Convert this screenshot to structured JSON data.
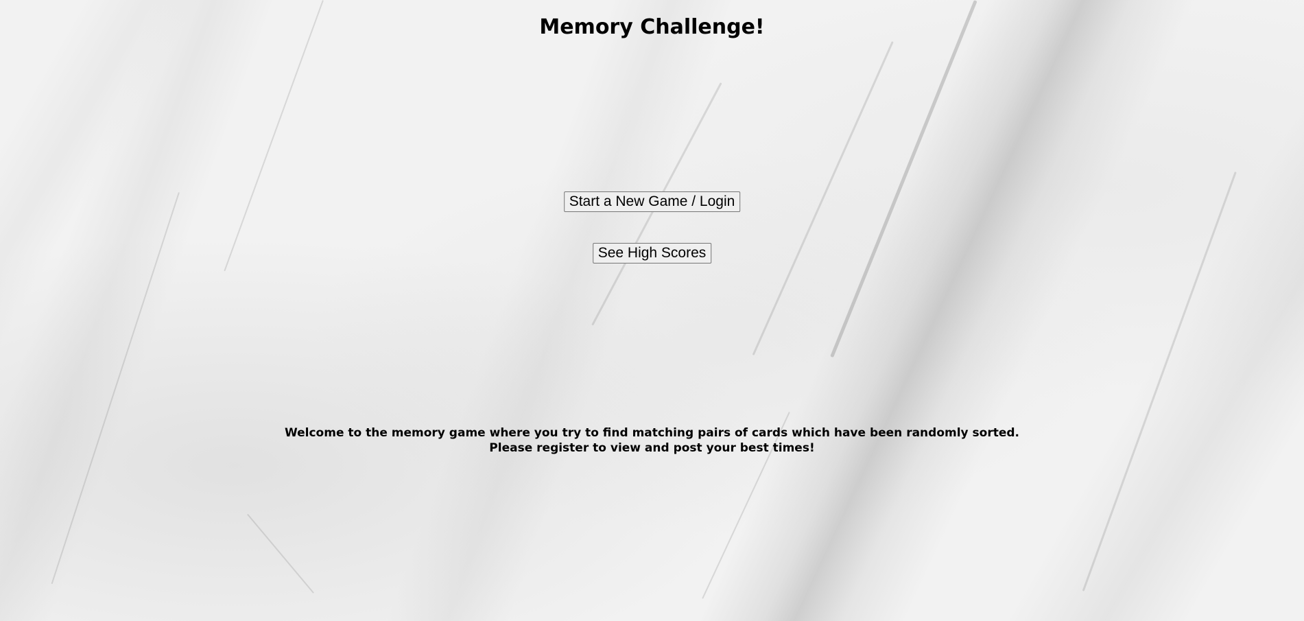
{
  "page": {
    "title": "Memory Challenge!"
  },
  "buttons": {
    "start_label": "Start a New Game / Login",
    "scores_label": "See High Scores"
  },
  "welcome": {
    "line1": "Welcome to the memory game where you try to find matching pairs of cards which have been randomly sorted.",
    "line2": "Please register to view and post your best times!"
  },
  "colors": {
    "background": "#f2f2f2",
    "text": "#000000",
    "button_bg": "#efefef",
    "button_border": "#767676"
  }
}
